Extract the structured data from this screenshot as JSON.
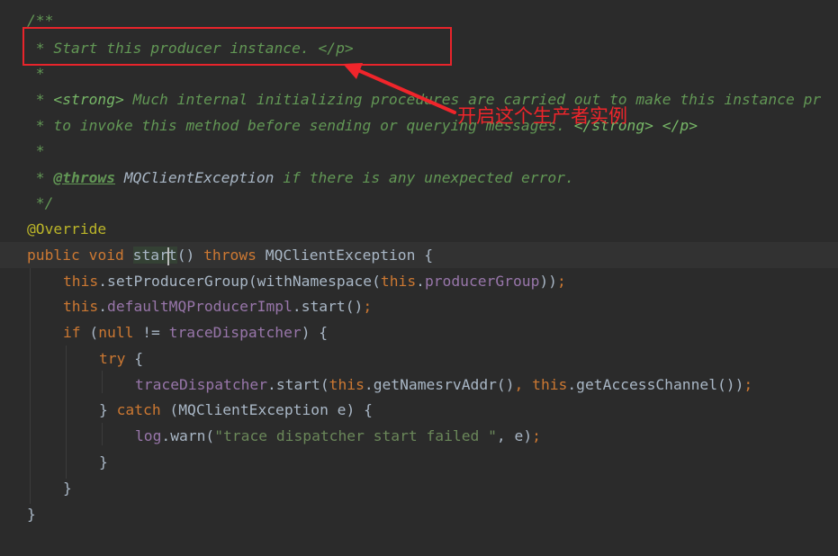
{
  "annotation": {
    "label": "开启这个生产者实例",
    "color": "#e8242b"
  },
  "code": {
    "doc_open": "/**",
    "doc_line1": " * Start this producer instance. </p>",
    "doc_star": " *",
    "doc_line3_prefix": " * ",
    "doc_line3_tag": "<strong>",
    "doc_line3_text": " Much internal initializing procedures are carried out to make this instance pr",
    "doc_line4_prefix": " * to invoke this method before sending or querying messages. ",
    "doc_line4_tag1": "</strong>",
    "doc_line4_space": " ",
    "doc_line4_tag2": "</p>",
    "doc_throws_prefix": " * ",
    "doc_throws_tag": "@throws",
    "doc_throws_ref": " MQClientException",
    "doc_throws_text": " if there is any unexpected error.",
    "doc_close": " */",
    "annotation_override": "@Override",
    "kw_public": "public",
    "kw_void": "void",
    "method_start_a": "star",
    "method_start_b": "t",
    "sig_parens": "()",
    "kw_throws": "throws",
    "exc_type": "MQClientException",
    "brace_open": " {",
    "kw_this": "this",
    "dot": ".",
    "setProducerGroup": "setProducerGroup(withNamespace(",
    "producerGroup": "producerGroup",
    "close_two": "))",
    "semicolon": ";",
    "defaultImpl": "defaultMQProducerImpl",
    "start_call": ".start()",
    "kw_if": "if",
    "if_open": " (",
    "kw_null": "null",
    "neq": " != ",
    "traceDispatcher": "traceDispatcher",
    "if_close": ") {",
    "kw_try": "try",
    "try_brace": " {",
    "start_open": ".start(",
    "getNamesrv": ".getNamesrvAddr()",
    "comma_space": ", ",
    "getAccess": ".getAccessChannel()",
    "close_one": ")",
    "catch_close_brace": "} ",
    "kw_catch": "catch",
    "catch_params": " (MQClientException e) {",
    "log_field": "log",
    "warn_open": ".warn(",
    "warn_string": "\"trace dispatcher start failed \"",
    "warn_rest": ", e)",
    "close_brace": "}"
  }
}
